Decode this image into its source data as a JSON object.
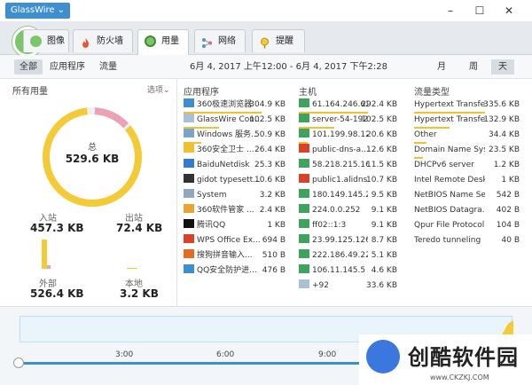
{
  "app": {
    "menu_label": "GlassWire ⌄"
  },
  "tabs": [
    {
      "label": "图像"
    },
    {
      "label": "防火墙"
    },
    {
      "label": "用量"
    },
    {
      "label": "网络"
    },
    {
      "label": "提醒"
    }
  ],
  "filters": {
    "all": "全部",
    "apps": "应用程序",
    "traffic": "流量"
  },
  "date_range": "6月 4, 2017 上午12:00  -  6月 4, 2017 下午2:28",
  "periods": {
    "month": "月",
    "week": "周",
    "day": "天"
  },
  "left": {
    "header": "所有用量",
    "options": "选项⌄",
    "total_label": "总",
    "total_value": "529.6 KB",
    "incoming_label": "入站",
    "incoming_value": "457.3 KB",
    "outgoing_label": "出站",
    "outgoing_value": "72.4 KB",
    "external_label": "外部",
    "external_value": "526.4 KB",
    "local_label": "本地",
    "local_value": "3.2 KB",
    "donut_incoming_fraction": 0.86
  },
  "apps": {
    "header": "应用程序",
    "rows": [
      {
        "name": "360极速浏览器",
        "value": "304.9 KB"
      },
      {
        "name": "GlassWire Con...",
        "value": "102.5 KB"
      },
      {
        "name": "Windows 服务...",
        "value": "50.9 KB"
      },
      {
        "name": "360安全卫士 ...",
        "value": "26.4 KB"
      },
      {
        "name": "BaiduNetdisk",
        "value": "25.3 KB"
      },
      {
        "name": "gidot typesett...",
        "value": "10.6 KB"
      },
      {
        "name": "System",
        "value": "3.2 KB"
      },
      {
        "name": "360软件管家 ...",
        "value": "2.4 KB"
      },
      {
        "name": "腾讯QQ",
        "value": "1 KB"
      },
      {
        "name": "WPS Office Ex...",
        "value": "694 B"
      },
      {
        "name": "搜狗拼音输入...",
        "value": "510 B"
      },
      {
        "name": "QQ安全防护进...",
        "value": "476 B"
      }
    ]
  },
  "hosts": {
    "header": "主机",
    "rows": [
      {
        "name": "61.164.246.62",
        "value": "292.4 KB"
      },
      {
        "name": "server-54-192...",
        "value": "102.5 KB"
      },
      {
        "name": "101.199.98.125",
        "value": "20.6 KB"
      },
      {
        "name": "public-dns-a...",
        "value": "12.6 KB"
      },
      {
        "name": "58.218.215.164",
        "value": "11.5 KB"
      },
      {
        "name": "public1.alidns...",
        "value": "10.7 KB"
      },
      {
        "name": "180.149.145.241",
        "value": "9.5 KB"
      },
      {
        "name": "224.0.0.252",
        "value": "9.1 KB"
      },
      {
        "name": "ff02::1:3",
        "value": "9.1 KB"
      },
      {
        "name": "23.99.125.126",
        "value": "8.7 KB"
      },
      {
        "name": "222.186.49.224",
        "value": "5.1 KB"
      },
      {
        "name": "106.11.145.5",
        "value": "4.6 KB"
      },
      {
        "name": "+92",
        "value": "33.6 KB"
      }
    ]
  },
  "traffic": {
    "header": "流量类型",
    "rows": [
      {
        "name": "Hypertext Transfe...",
        "value": "335.6 KB"
      },
      {
        "name": "Hypertext Transfe...",
        "value": "132.9 KB"
      },
      {
        "name": "Other",
        "value": "34.4 KB"
      },
      {
        "name": "Domain Name Sys...",
        "value": "23.5 KB"
      },
      {
        "name": "DHCPv6 server",
        "value": "1.2 KB"
      },
      {
        "name": "Intel Remote Desk...",
        "value": "1 KB"
      },
      {
        "name": "NetBIOS Name Se...",
        "value": "542 B"
      },
      {
        "name": "NetBIOS Datagra...",
        "value": "402 B"
      },
      {
        "name": "Qpur File Protocol",
        "value": "104 B"
      },
      {
        "name": "Teredo tunneling",
        "value": "40 B"
      }
    ]
  },
  "graph": {
    "times": [
      "3:00",
      "6:00",
      "9:00"
    ]
  },
  "watermark": {
    "name": "创酷软件园",
    "url": "www.CKZKJ.COM"
  }
}
